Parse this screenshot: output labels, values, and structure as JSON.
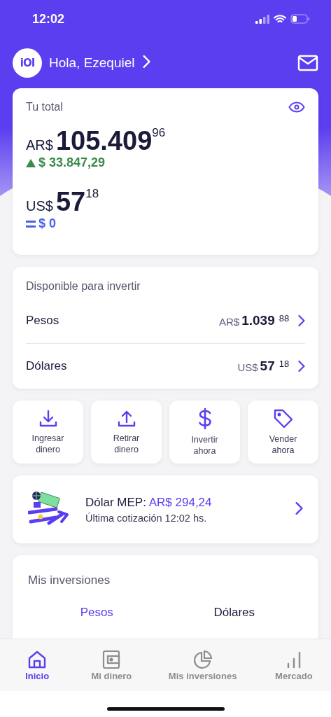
{
  "status_bar": {
    "time": "12:02"
  },
  "header": {
    "logo": "iOI",
    "greeting": "Hola, Ezequiel"
  },
  "total_card": {
    "title": "Tu total",
    "balances": [
      {
        "currency": "AR$",
        "amount": "105.409",
        "cents": "96",
        "change": "$ 33.847,29",
        "kind": "up"
      },
      {
        "currency": "US$",
        "amount": "57",
        "cents": "18",
        "change": "$ 0",
        "kind": "flat"
      }
    ]
  },
  "available_card": {
    "title": "Disponible para invertir",
    "rows": [
      {
        "label": "Pesos",
        "currency": "AR$",
        "amount": "1.039",
        "cents": "88"
      },
      {
        "label": "Dólares",
        "currency": "US$",
        "amount": "57",
        "cents": "18"
      }
    ]
  },
  "actions": [
    {
      "kind": "download",
      "label": "Ingresar dinero"
    },
    {
      "kind": "upload",
      "label": "Retirar dinero"
    },
    {
      "kind": "dollar",
      "label": "Invertir ahora"
    },
    {
      "kind": "tag",
      "label": "Vender ahora"
    }
  ],
  "mep_card": {
    "label": "Dólar MEP:",
    "value": "AR$ 294,24",
    "subtitle": "Última cotización 12:02 hs."
  },
  "investments_card": {
    "title": "Mis inversiones",
    "tabs": [
      {
        "label": "Pesos",
        "selected": true
      },
      {
        "label": "Dólares",
        "selected": false
      }
    ]
  },
  "tab_bar": [
    {
      "kind": "home",
      "label": "Inicio",
      "selected": true
    },
    {
      "kind": "wallet",
      "label": "Mi dinero",
      "selected": false
    },
    {
      "kind": "pie",
      "label": "Mis inversiones",
      "selected": false
    },
    {
      "kind": "bars",
      "label": "Mercado",
      "selected": false
    }
  ]
}
